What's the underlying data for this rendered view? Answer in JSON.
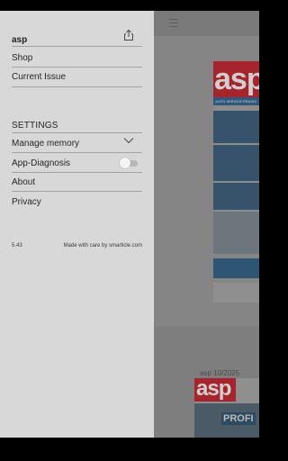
{
  "drawer": {
    "title": "asp",
    "share_icon": "share-icon",
    "menu": [
      {
        "label": "Shop"
      },
      {
        "label": "Current Issue"
      }
    ],
    "settings": {
      "heading": "SETTINGS",
      "items": [
        {
          "label": "Manage memory",
          "icon": "chevron-down-icon"
        },
        {
          "label": "App-Diagnosis",
          "control": "toggle",
          "enabled": false
        },
        {
          "label": "About"
        },
        {
          "label": "Privacy"
        }
      ]
    },
    "footer": {
      "version": "5.43",
      "credits": "Made with care by smarticle.com"
    }
  },
  "background": {
    "cover1": {
      "logo": "asp",
      "strip": "AUTO SERVICE PRAXIS"
    },
    "issue_label": "asp 10/2025",
    "cover2": {
      "logo": "asp",
      "headline": "PROFI"
    }
  },
  "colors": {
    "drawer_bg": "#d8d8d8",
    "separator": "#a3a3a3",
    "brand_red": "#a8242c",
    "brand_blue": "#2e5674"
  }
}
